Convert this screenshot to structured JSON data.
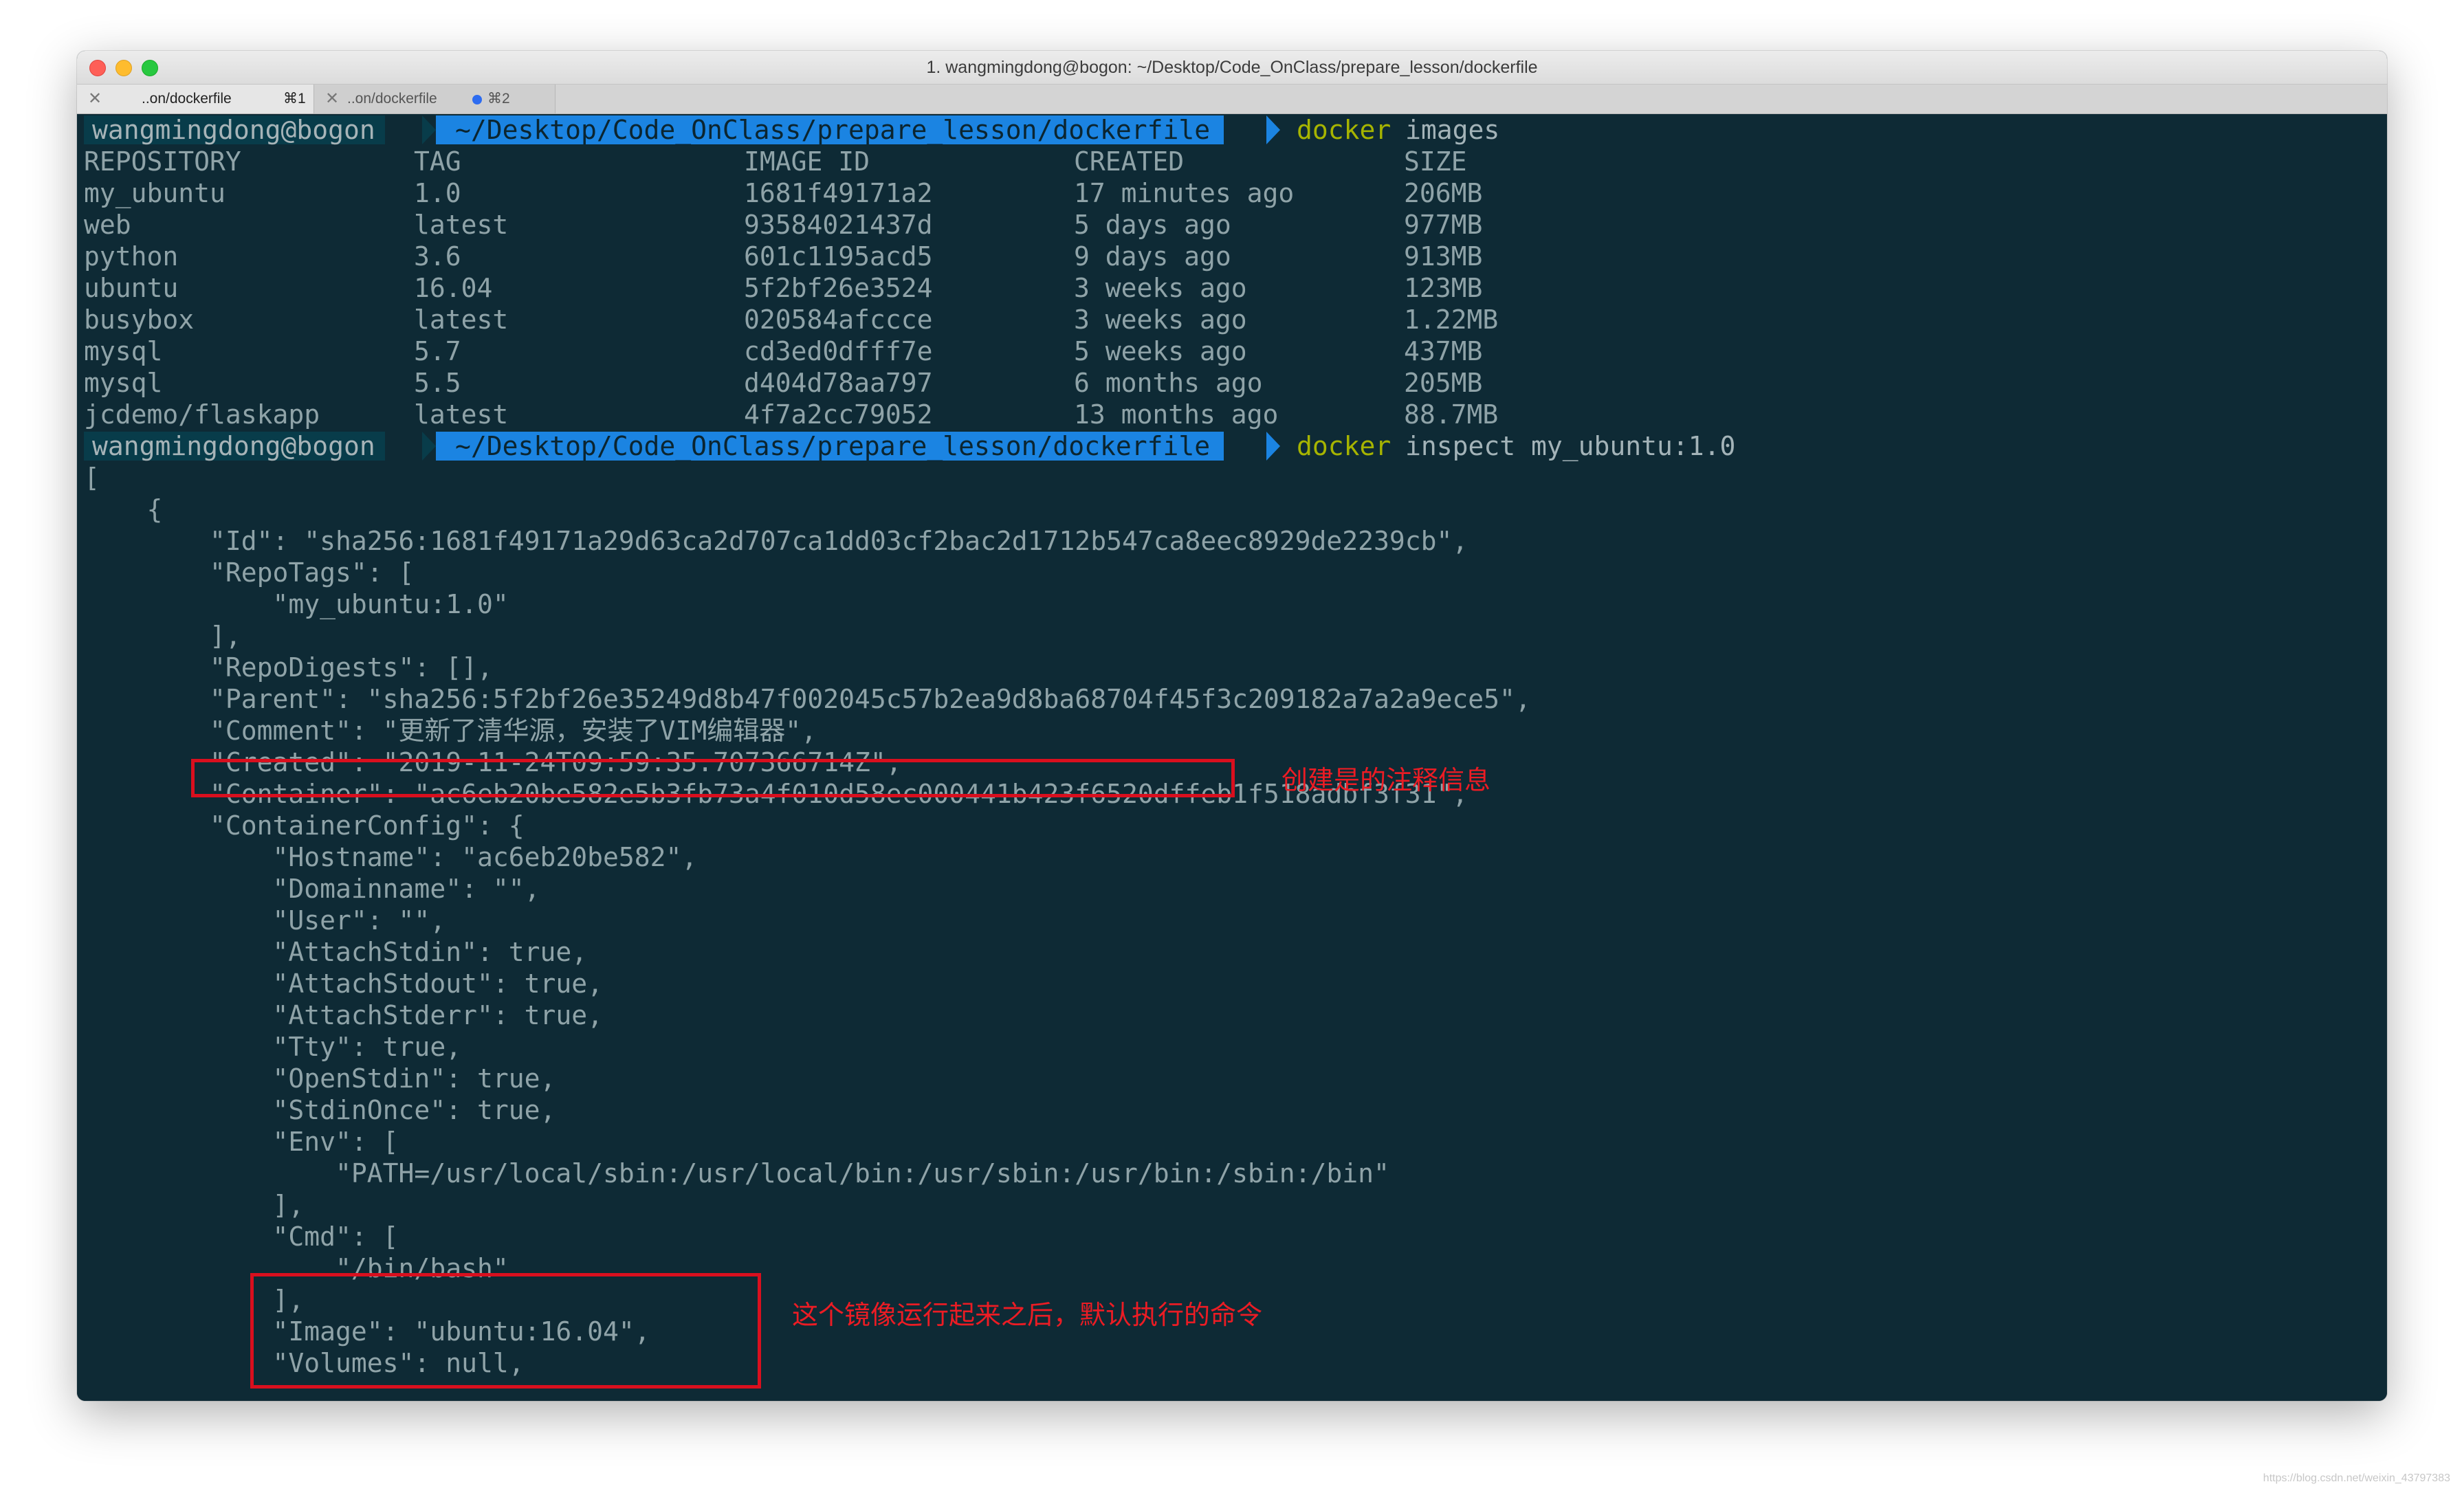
{
  "window": {
    "title": "1. wangmingdong@bogon: ~/Desktop/Code_OnClass/prepare_lesson/dockerfile"
  },
  "tabs": [
    {
      "title": "..on/dockerfile",
      "shortcut": "⌘1",
      "close": "✕"
    },
    {
      "title": "..on/dockerfile",
      "shortcut": "⌘2",
      "close": "✕"
    }
  ],
  "prompt": {
    "user": "wangmingdong@bogon",
    "path": "~/Desktop/Code_OnClass/prepare_lesson/dockerfile"
  },
  "commands": [
    {
      "word": "docker",
      "args": "images"
    },
    {
      "word": "docker",
      "args": "inspect my_ubuntu:1.0"
    }
  ],
  "images_table": {
    "headers": [
      "REPOSITORY",
      "TAG",
      "IMAGE ID",
      "CREATED",
      "SIZE"
    ],
    "rows": [
      [
        "my_ubuntu",
        "1.0",
        "1681f49171a2",
        "17 minutes ago",
        "206MB"
      ],
      [
        "web",
        "latest",
        "93584021437d",
        "5 days ago",
        "977MB"
      ],
      [
        "python",
        "3.6",
        "601c1195acd5",
        "9 days ago",
        "913MB"
      ],
      [
        "ubuntu",
        "16.04",
        "5f2bf26e3524",
        "3 weeks ago",
        "123MB"
      ],
      [
        "busybox",
        "latest",
        "020584afccce",
        "3 weeks ago",
        "1.22MB"
      ],
      [
        "mysql",
        "5.7",
        "cd3ed0dfff7e",
        "5 weeks ago",
        "437MB"
      ],
      [
        "mysql",
        "5.5",
        "d404d78aa797",
        "6 months ago",
        "205MB"
      ],
      [
        "jcdemo/flaskapp",
        "latest",
        "4f7a2cc79052",
        "13 months ago",
        "88.7MB"
      ]
    ]
  },
  "inspect_lines": [
    "[",
    "    {",
    "        \"Id\": \"sha256:1681f49171a29d63ca2d707ca1dd03cf2bac2d1712b547ca8eec8929de2239cb\",",
    "        \"RepoTags\": [",
    "            \"my_ubuntu:1.0\"",
    "        ],",
    "        \"RepoDigests\": [],",
    "        \"Parent\": \"sha256:5f2bf26e35249d8b47f002045c57b2ea9d8ba68704f45f3c209182a7a2a9ece5\",",
    "        \"Comment\": \"更新了清华源，安装了VIM编辑器\",",
    "        \"Created\": \"2019-11-24T09:59:35.707366714Z\",",
    "        \"Container\": \"ac6eb20be582e5b3fb73a4f010d58ec000441b423f6520dffeb1f518adbf3f31\",",
    "        \"ContainerConfig\": {",
    "            \"Hostname\": \"ac6eb20be582\",",
    "            \"Domainname\": \"\",",
    "            \"User\": \"\",",
    "            \"AttachStdin\": true,",
    "            \"AttachStdout\": true,",
    "            \"AttachStderr\": true,",
    "            \"Tty\": true,",
    "            \"OpenStdin\": true,",
    "            \"StdinOnce\": true,",
    "            \"Env\": [",
    "                \"PATH=/usr/local/sbin:/usr/local/bin:/usr/sbin:/usr/bin:/sbin:/bin\"",
    "            ],",
    "            \"Cmd\": [",
    "                \"/bin/bash\"",
    "            ],",
    "            \"Image\": \"ubuntu:16.04\",",
    "            \"Volumes\": null,"
  ],
  "annotations": {
    "comment_note": "创建是的注释信息",
    "cmd_note": "这个镜像运行起来之后，默认执行的命令",
    "color": "#e5101e"
  },
  "watermark": "https://blog.csdn.net/weixin_43797383",
  "colors": {
    "terminal_bg": "#0e2a35",
    "text": "#8fa3a8",
    "path_bg": "#1b84e2",
    "user_bg": "#083c4a",
    "command": "#a6b400"
  }
}
